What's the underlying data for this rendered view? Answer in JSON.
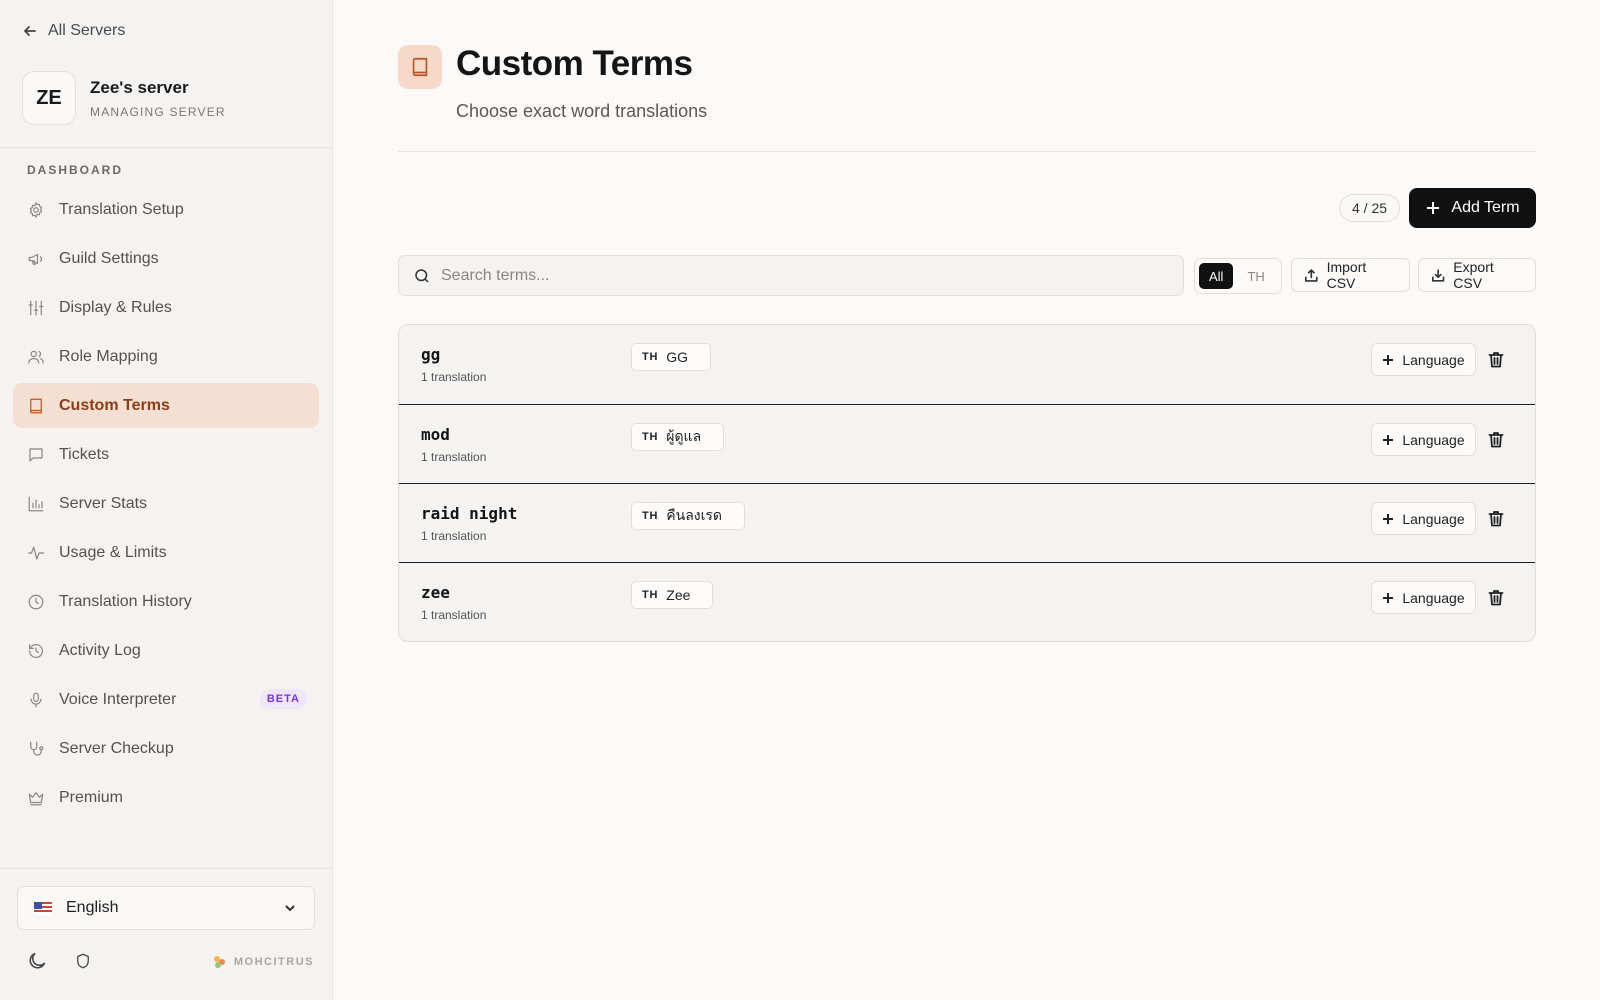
{
  "sidebar": {
    "back_label": "All Servers",
    "server": {
      "initials": "ZE",
      "name": "Zee's server",
      "subtitle": "MANAGING SERVER"
    },
    "section_label": "DASHBOARD",
    "items": [
      {
        "label": "Translation Setup",
        "icon": "gear-icon",
        "active": false
      },
      {
        "label": "Guild Settings",
        "icon": "megaphone-icon",
        "active": false
      },
      {
        "label": "Display & Rules",
        "icon": "sliders-icon",
        "active": false
      },
      {
        "label": "Role Mapping",
        "icon": "users-icon",
        "active": false
      },
      {
        "label": "Custom Terms",
        "icon": "book-icon",
        "active": true
      },
      {
        "label": "Tickets",
        "icon": "chat-icon",
        "active": false
      },
      {
        "label": "Server Stats",
        "icon": "bar-chart-icon",
        "active": false
      },
      {
        "label": "Usage & Limits",
        "icon": "activity-icon",
        "active": false
      },
      {
        "label": "Translation History",
        "icon": "clock-icon",
        "active": false
      },
      {
        "label": "Activity Log",
        "icon": "history-icon",
        "active": false
      },
      {
        "label": "Voice Interpreter",
        "icon": "mic-icon",
        "active": false,
        "badge": "BETA"
      },
      {
        "label": "Server Checkup",
        "icon": "stethoscope-icon",
        "active": false
      },
      {
        "label": "Premium",
        "icon": "crown-icon",
        "active": false
      }
    ],
    "language": {
      "flag": "us-flag-icon",
      "selected": "English"
    },
    "brand": "MOHCITRUS"
  },
  "main": {
    "title": "Custom Terms",
    "subtitle": "Choose exact word translations",
    "count": "4 / 25",
    "add_button": "Add Term",
    "search_placeholder": "Search terms...",
    "filters": [
      "All",
      "TH"
    ],
    "active_filter": "All",
    "import_label": "Import CSV",
    "export_label": "Export CSV",
    "language_button": "Language",
    "terms": [
      {
        "word": "gg",
        "count": "1 translation",
        "code": "TH",
        "translation": "GG"
      },
      {
        "word": "mod",
        "count": "1 translation",
        "code": "TH",
        "translation": "ผู้ดูแล"
      },
      {
        "word": "raid night",
        "count": "1 translation",
        "code": "TH",
        "translation": "คืนลงเรด"
      },
      {
        "word": "zee",
        "count": "1 translation",
        "code": "TH",
        "translation": "Zee"
      }
    ]
  },
  "colors": {
    "accent": "#b5562a",
    "active_bg": "#f5dfd2",
    "primary_button": "#111111",
    "beta": "#7b35d1"
  }
}
